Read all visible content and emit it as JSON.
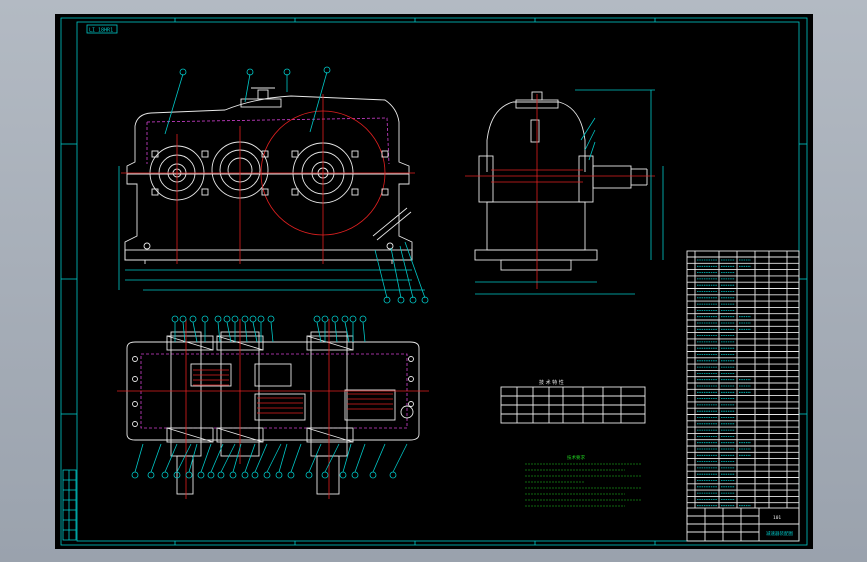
{
  "drawing": {
    "frame_stamp": "LI 18HR1",
    "note_header": "技术要求",
    "param_table_title": "技 术 特 性",
    "title_block_code": "101",
    "title_block_name": "减速器装配图"
  },
  "colors": {
    "background": "#000000",
    "frame": "#00c8c8",
    "geometry": "#e8e8e8",
    "centerline": "#e02020",
    "hidden": "#d040d0",
    "notes": "#20d020"
  }
}
